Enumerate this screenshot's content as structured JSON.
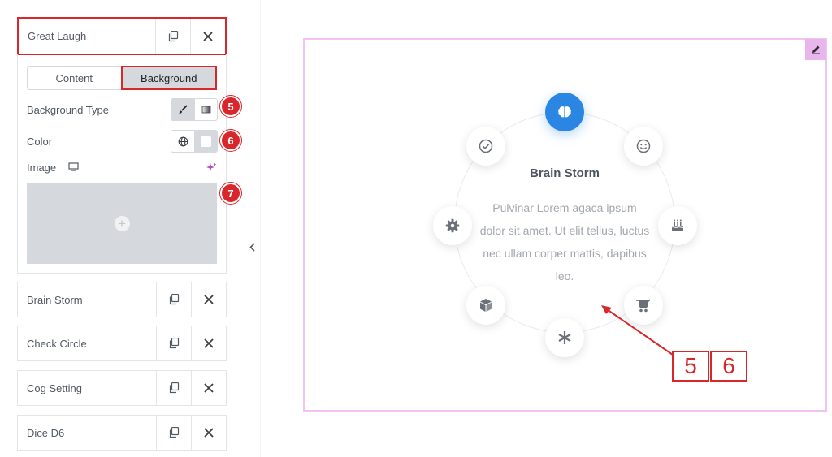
{
  "repeater_items": [
    {
      "title": "Great Laugh",
      "active": true
    },
    {
      "title": "Brain Storm"
    },
    {
      "title": "Check Circle"
    },
    {
      "title": "Cog Setting"
    },
    {
      "title": "Dice D6"
    }
  ],
  "tabs": {
    "content": "Content",
    "background": "Background",
    "selected": "Background"
  },
  "fields": {
    "background_type": "Background Type",
    "color": "Color",
    "image": "Image"
  },
  "badges": {
    "b5": "5",
    "b6": "6",
    "b7": "7"
  },
  "preview": {
    "title": "Brain Storm",
    "text": "Pulvinar Lorem agaca ipsum dolor sit amet. Ut elit tellus, luctus nec ullam corper mattis, dapibus leo.",
    "nodes": [
      "brain-icon",
      "smile-icon",
      "birthday-cake-icon",
      "baby-carriage-icon",
      "asterisk-icon",
      "cube-icon",
      "cog-icon",
      "check-circle-icon"
    ]
  },
  "annotation": {
    "box1": "5",
    "box2": "6"
  },
  "colors": {
    "accent_red": "#d9262a",
    "primary_blue": "#2b86e3",
    "preview_border": "#f0c3f3"
  }
}
